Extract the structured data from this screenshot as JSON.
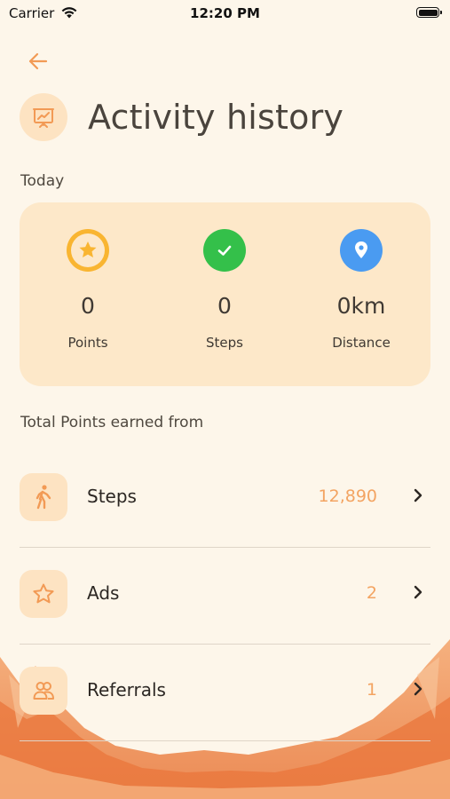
{
  "status_bar": {
    "carrier": "Carrier",
    "time": "12:20 PM"
  },
  "header": {
    "title": "Activity history"
  },
  "today": {
    "label": "Today",
    "stats": [
      {
        "value": "0",
        "label": "Points",
        "icon": "star-icon",
        "color": "#f9b531"
      },
      {
        "value": "0",
        "label": "Steps",
        "icon": "check-icon",
        "color": "#34c04a"
      },
      {
        "value": "0km",
        "label": "Distance",
        "icon": "location-pin-icon",
        "color": "#4a9bf1"
      }
    ]
  },
  "total": {
    "label": "Total Points earned from",
    "rows": [
      {
        "label": "Steps",
        "value": "12,890",
        "icon": "walking-icon"
      },
      {
        "label": "Ads",
        "value": "2",
        "icon": "star-outline-icon"
      },
      {
        "label": "Referrals",
        "value": "1",
        "icon": "users-icon"
      }
    ]
  },
  "colors": {
    "background": "#fdf6ea",
    "card": "#fde8c9",
    "accent": "#f3a462"
  }
}
